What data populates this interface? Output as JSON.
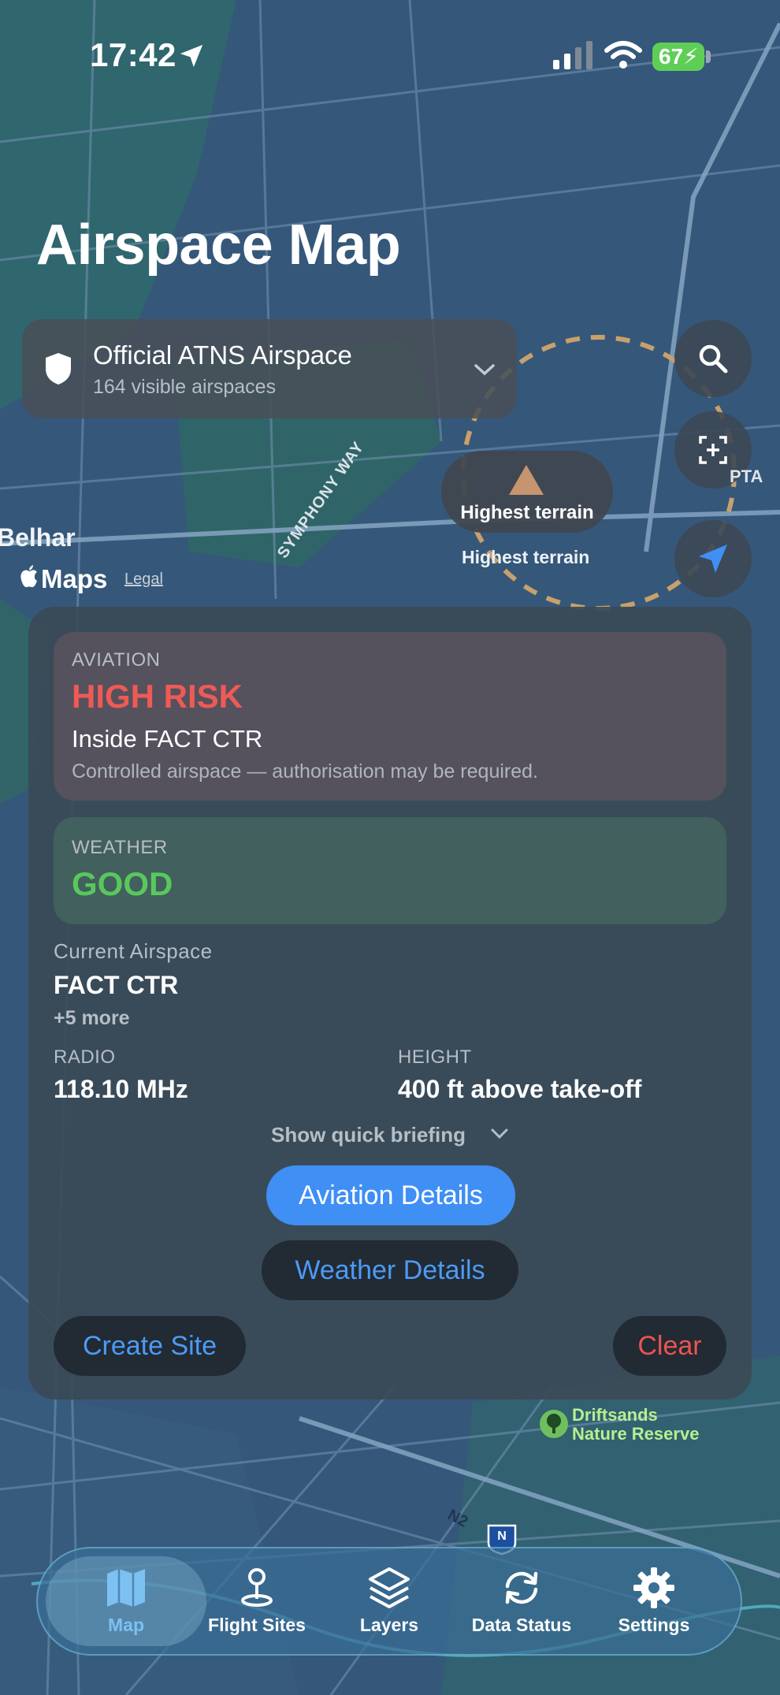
{
  "status_bar": {
    "time": "17:42",
    "battery": "67"
  },
  "page_title": "Airspace Map",
  "airspace_selector": {
    "title": "Official ATNS Airspace",
    "subtitle": "164 visible airspaces"
  },
  "map": {
    "terrain_pin_label": "Highest terrain",
    "terrain_label": "Highest terrain",
    "place_belhar": "Belhar",
    "street_symphony": "SYMPHONY WAY",
    "place_pta": "PTA",
    "maps_brand": "Maps",
    "legal": "Legal",
    "poi_name_line1": "Driftsands",
    "poi_name_line2": "Nature Reserve",
    "road_n2": "N2",
    "route_shield": "N"
  },
  "briefing": {
    "aviation_caption": "AVIATION",
    "aviation_risk": "HIGH RISK",
    "aviation_zone": "Inside FACT CTR",
    "aviation_note": "Controlled airspace — authorisation may be required.",
    "weather_caption": "WEATHER",
    "weather_status": "GOOD",
    "current_airspace_caption": "Current Airspace",
    "current_airspace": "FACT CTR",
    "more": "+5 more",
    "radio_caption": "RADIO",
    "radio_value": "118.10 MHz",
    "height_caption": "HEIGHT",
    "height_value": "400 ft above take-off",
    "quick_briefing": "Show quick briefing",
    "aviation_details_button": "Aviation Details",
    "weather_details_button": "Weather Details",
    "create_site_button": "Create Site",
    "clear_button": "Clear"
  },
  "tabs": [
    {
      "label": "Map",
      "icon": "map-icon",
      "active": true
    },
    {
      "label": "Flight Sites",
      "icon": "pin-icon",
      "active": false
    },
    {
      "label": "Layers",
      "icon": "layers-icon",
      "active": false
    },
    {
      "label": "Data Status",
      "icon": "sync-icon",
      "active": false
    },
    {
      "label": "Settings",
      "icon": "gear-icon",
      "active": false
    }
  ],
  "colors": {
    "high_risk": "#ef5a55",
    "good": "#59c85c",
    "accent": "#3f8ff5",
    "clear": "#ec5450"
  }
}
